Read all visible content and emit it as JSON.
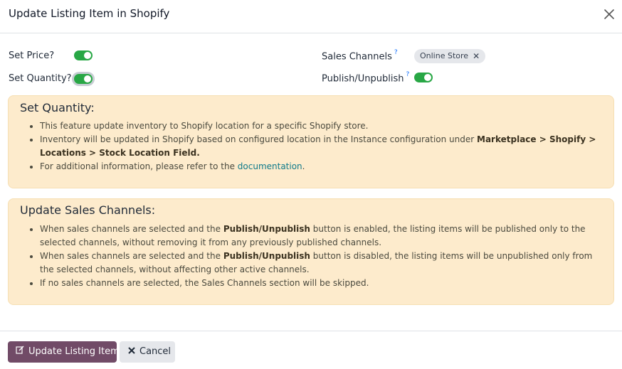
{
  "dialog": {
    "title": "Update Listing Item in Shopify",
    "close_icon": "close-icon"
  },
  "form": {
    "set_price_label": "Set Price?",
    "set_price_value": true,
    "set_quantity_label": "Set Quantity?",
    "set_quantity_value": true,
    "sales_channels_label": "Sales Channels",
    "sales_channels_help": "?",
    "sales_channels_tags": [
      "Online Store"
    ],
    "tag_remove": "✕",
    "publish_label": "Publish/Unpublish",
    "publish_help": "?",
    "publish_value": true
  },
  "set_quantity_box": {
    "title": "Set Quantity:",
    "item1": "This feature update inventory to Shopify location for a specific Shopify store.",
    "item2_pre": "Inventory will be updated in Shopify based on configured location in the Instance configuration under ",
    "item2_bold": "Marketplace > Shopify > Locations > Stock Location Field.",
    "item3_pre": "For additional information, please refer to the ",
    "item3_link": "documentation",
    "item3_post": "."
  },
  "sales_channels_box": {
    "title": "Update Sales Channels:",
    "item1_pre": "When sales channels are selected and the ",
    "item1_bold": "Publish/Unpublish",
    "item1_post": " button is enabled, the listing items will be published only to the selected channels, without removing it from any previously published channels.",
    "item2_pre": "When sales channels are selected and the ",
    "item2_bold": "Publish/Unpublish",
    "item2_post": " button is disabled, the listing items will be unpublished only from the selected channels, without affecting other active channels.",
    "item3": "If no sales channels are selected, the Sales Channels section will be skipped."
  },
  "footer": {
    "update_label": "Update Listing Item",
    "update_icon": "edit-icon",
    "cancel_label": "Cancel",
    "cancel_icon": "close-icon"
  },
  "colors": {
    "primary": "#714b67",
    "toggle_on": "#28a745",
    "info_bg": "#fdebcc",
    "link": "#0f7a8a"
  }
}
